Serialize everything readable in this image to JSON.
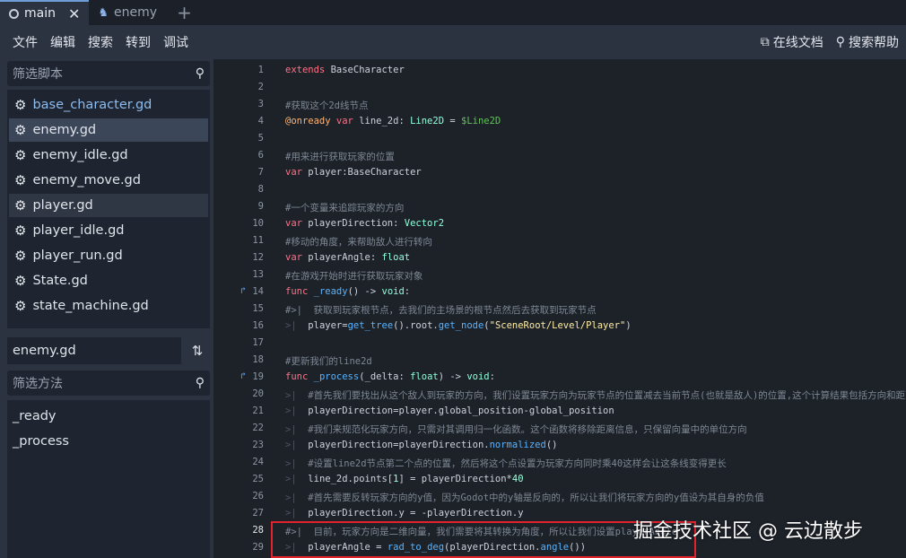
{
  "tabs": [
    {
      "label": "main",
      "icon": "scene-circle-icon",
      "active": true
    },
    {
      "label": "enemy",
      "icon": "character-scene-icon",
      "active": false
    }
  ],
  "menu": [
    "文件",
    "编辑",
    "搜索",
    "转到",
    "调试"
  ],
  "help_links": [
    {
      "label": "在线文档",
      "icon": "external-link-icon"
    },
    {
      "label": "搜索帮助",
      "icon": "search-help-icon"
    }
  ],
  "sidebar": {
    "filter_scripts_placeholder": "筛选脚本",
    "scripts": [
      "base_character.gd",
      "enemy.gd",
      "enemy_idle.gd",
      "enemy_move.gd",
      "player.gd",
      "player_idle.gd",
      "player_run.gd",
      "State.gd",
      "state_machine.gd"
    ],
    "current_script": "enemy.gd",
    "filter_methods_placeholder": "筛选方法",
    "methods": [
      "_ready",
      "_process"
    ]
  },
  "editor": {
    "line_numbers": [
      "1",
      "2",
      "3",
      "4",
      "5",
      "6",
      "7",
      "8",
      "9",
      "10",
      "11",
      "12",
      "13",
      "14",
      "15",
      "16",
      "17",
      "18",
      "19",
      "20",
      "21",
      "22",
      "23",
      "24",
      "25",
      "26",
      "27",
      "28",
      "29"
    ]
  },
  "watermark": "掘金技术社区 @ 云边散步",
  "colors": {
    "accent": "#6e9dd8",
    "highlight_box": "#e3222c"
  }
}
